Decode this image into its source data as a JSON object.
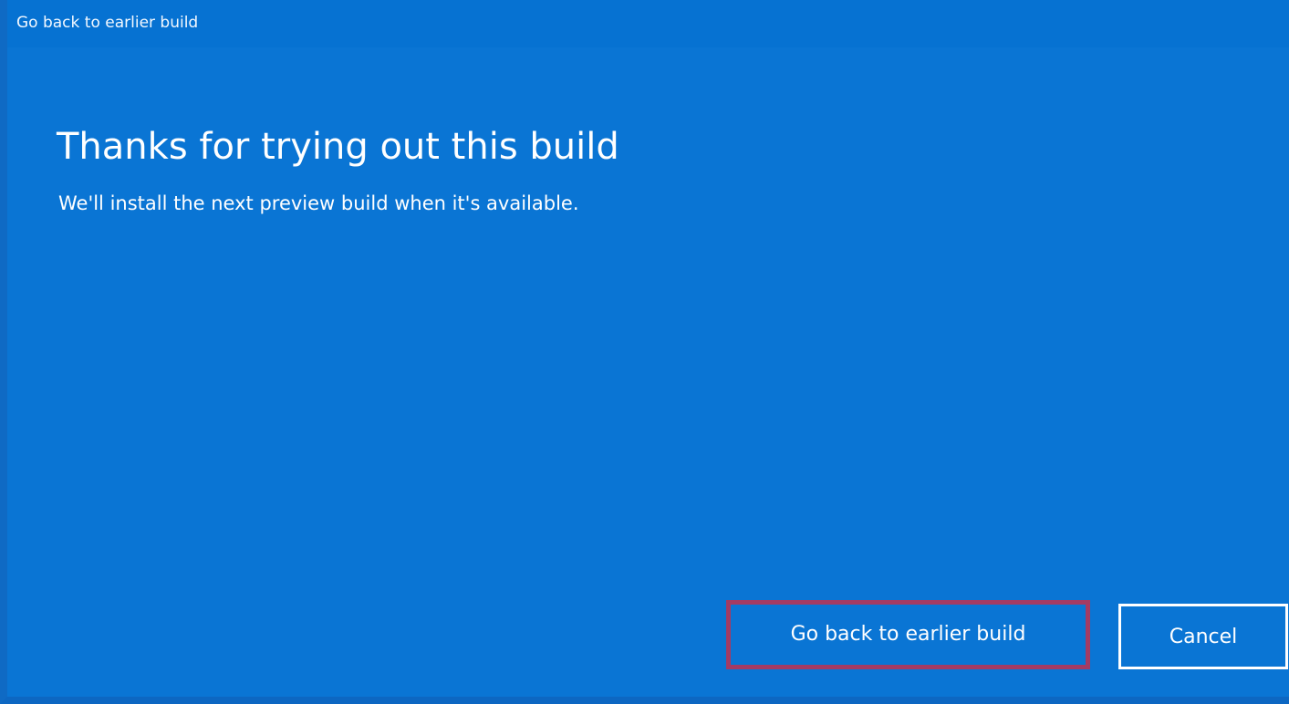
{
  "window": {
    "title": "Go back to earlier build"
  },
  "content": {
    "heading": "Thanks for trying out this build",
    "message": "We'll install the next preview build when it's available."
  },
  "buttons": {
    "primary_label": "Go back to earlier build",
    "cancel_label": "Cancel"
  },
  "colors": {
    "background": "#0a75d4",
    "highlight_border": "#a33b64",
    "text": "#ffffff"
  }
}
